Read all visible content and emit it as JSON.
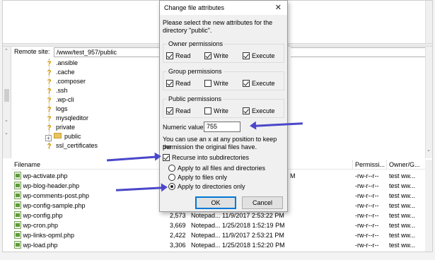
{
  "remote": {
    "label": "Remote site:",
    "path": "/www/test_957/public"
  },
  "tree": [
    {
      "name": ".ansible",
      "icon": "question-folder-icon"
    },
    {
      "name": ".cache",
      "icon": "question-folder-icon"
    },
    {
      "name": ".composer",
      "icon": "question-folder-icon"
    },
    {
      "name": ".ssh",
      "icon": "question-folder-icon"
    },
    {
      "name": ".wp-cli",
      "icon": "question-folder-icon"
    },
    {
      "name": "logs",
      "icon": "question-folder-icon"
    },
    {
      "name": "mysqleditor",
      "icon": "question-folder-icon"
    },
    {
      "name": "private",
      "icon": "question-folder-icon"
    },
    {
      "name": "public",
      "icon": "folder-icon"
    },
    {
      "name": "ssl_certificates",
      "icon": "question-folder-icon"
    }
  ],
  "list": {
    "headers": {
      "filename": "Filename",
      "permissions": "Permissi...",
      "owner": "Owner/G..."
    },
    "rows": [
      {
        "name": "wp-activate.php",
        "size": "",
        "type": "",
        "modified": "M",
        "perm": "-rw-r--r--",
        "owner": "test ww..."
      },
      {
        "name": "wp-blog-header.php",
        "size": "",
        "type": "",
        "modified": "",
        "perm": "-rw-r--r--",
        "owner": "test ww..."
      },
      {
        "name": "wp-comments-post.php",
        "size": "",
        "type": "",
        "modified": "",
        "perm": "-rw-r--r--",
        "owner": "test ww..."
      },
      {
        "name": "wp-config-sample.php",
        "size": "",
        "type": "",
        "modified": "",
        "perm": "-rw-r--r--",
        "owner": "test ww..."
      },
      {
        "name": "wp-config.php",
        "size": "2,573",
        "type": "Notepad...",
        "modified": "11/9/2017 2:53:22 PM",
        "perm": "-rw-r--r--",
        "owner": "test ww..."
      },
      {
        "name": "wp-cron.php",
        "size": "3,669",
        "type": "Notepad...",
        "modified": "1/25/2018 1:52:19 PM",
        "perm": "-rw-r--r--",
        "owner": "test ww..."
      },
      {
        "name": "wp-links-opml.php",
        "size": "2,422",
        "type": "Notepad...",
        "modified": "11/9/2017 2:53:21 PM",
        "perm": "-rw-r--r--",
        "owner": "test ww..."
      },
      {
        "name": "wp-load.php",
        "size": "3,306",
        "type": "Notepad...",
        "modified": "1/25/2018 1:52:20 PM",
        "perm": "-rw-r--r--",
        "owner": "test ww..."
      }
    ]
  },
  "dialog": {
    "title": "Change file attributes",
    "close": "✕",
    "intro_line1": "Please select the new attributes for the",
    "intro_line2": "directory \"public\".",
    "groups": {
      "owner": "Owner permissions",
      "group": "Group permissions",
      "public": "Public permissions"
    },
    "labels": {
      "read": "Read",
      "write": "Write",
      "execute": "Execute"
    },
    "numeric_label": "Numeric value:",
    "numeric_value": "755",
    "hint_line1": "You can use an x at any position to keep the",
    "hint_line2": "permission the original files have.",
    "recurse": "Recurse into subdirectories",
    "apply_all": "Apply to all files and directories",
    "apply_files": "Apply to files only",
    "apply_dirs": "Apply to directories only",
    "ok": "OK",
    "cancel": "Cancel"
  },
  "colors": {
    "annotation_arrow": "#4a47c9"
  }
}
